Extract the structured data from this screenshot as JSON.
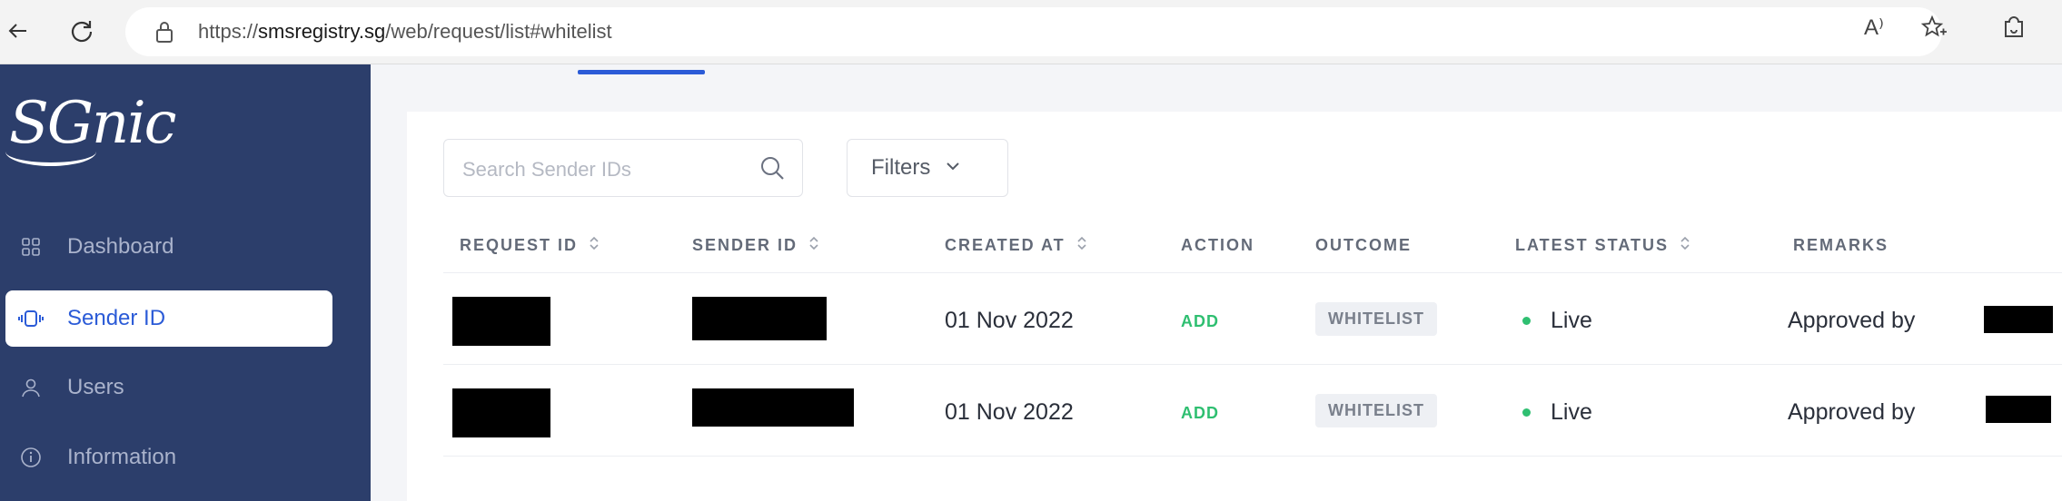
{
  "browser": {
    "url_prefix": "https://",
    "url_host": "smsregistry.sg",
    "url_path": "/web/request/list#whitelist",
    "read_aloud_label": "A⁾"
  },
  "sidebar": {
    "logo": "SGnic",
    "items": [
      {
        "label": "Dashboard",
        "icon": "grid-icon",
        "active": false
      },
      {
        "label": "Sender ID",
        "icon": "sender-id-icon",
        "active": true
      },
      {
        "label": "Users",
        "icon": "user-icon",
        "active": false
      },
      {
        "label": "Information",
        "icon": "info-icon",
        "active": false
      }
    ]
  },
  "toolbar": {
    "search_placeholder": "Search Sender IDs",
    "filters_label": "Filters"
  },
  "table": {
    "columns": [
      "REQUEST ID",
      "SENDER ID",
      "CREATED AT",
      "ACTION",
      "OUTCOME",
      "LATEST STATUS",
      "REMARKS"
    ],
    "rows": [
      {
        "created_at": "01 Nov 2022",
        "action": "ADD",
        "outcome": "WHITELIST",
        "status": "Live",
        "remarks": "Approved by"
      },
      {
        "created_at": "01 Nov 2022",
        "action": "ADD",
        "outcome": "WHITELIST",
        "status": "Live",
        "remarks": "Approved by"
      }
    ]
  },
  "colors": {
    "sidebar_bg": "#2c3e6b",
    "accent": "#2b5bd7",
    "success": "#2fbf71"
  }
}
